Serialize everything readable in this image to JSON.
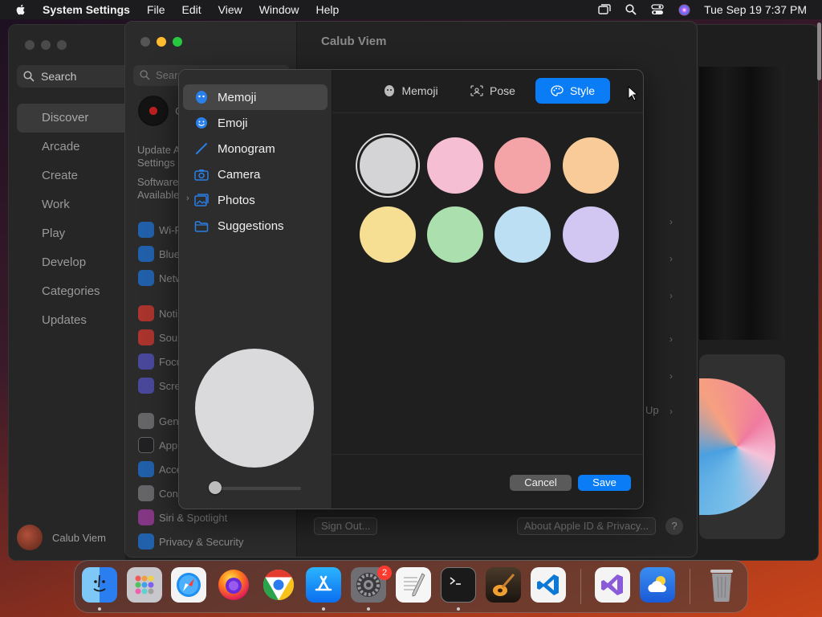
{
  "menubar": {
    "app_name": "System Settings",
    "menus": [
      "File",
      "Edit",
      "View",
      "Window",
      "Help"
    ],
    "clock": "Tue Sep 19  7:37 PM"
  },
  "appstore": {
    "search_label": "Search",
    "nav": [
      "Discover",
      "Arcade",
      "Create",
      "Work",
      "Play",
      "Develop",
      "Categories",
      "Updates"
    ],
    "active_nav": "Discover",
    "user_name": "Calub Viem"
  },
  "settings": {
    "window_title": "Calub Viem",
    "search_placeholder": "Search",
    "account_initial": "C",
    "update_line1": "Update A",
    "update_line2": "Settings",
    "software_line1": "Software",
    "software_line2": "Available",
    "sidebar_items": [
      {
        "label": "Wi-Fi",
        "color": "#1a84ff"
      },
      {
        "label": "Blue",
        "color": "#1a84ff"
      },
      {
        "label": "Netw",
        "color": "#1a84ff"
      },
      {
        "label": "Noti",
        "color": "#ff3b30"
      },
      {
        "label": "Sou",
        "color": "#ff3b30"
      },
      {
        "label": "Focu",
        "color": "#5e5ce6"
      },
      {
        "label": "Scre",
        "color": "#5e5ce6"
      },
      {
        "label": "Gen",
        "color": "#8e8e93"
      },
      {
        "label": "App",
        "color": "#1c1c1e"
      },
      {
        "label": "Acce",
        "color": "#1a84ff"
      },
      {
        "label": "Con",
        "color": "#8e8e93"
      },
      {
        "label": "Siri & Spotlight",
        "color": "#c040c0"
      },
      {
        "label": "Privacy & Security",
        "color": "#1a84ff"
      }
    ],
    "sign_out": "Sign Out...",
    "about": "About Apple ID & Privacy...",
    "help": "?",
    "up_fragment": "Up"
  },
  "dialog": {
    "sidebar": [
      {
        "label": "Memoji",
        "icon": "memoji-icon"
      },
      {
        "label": "Emoji",
        "icon": "emoji-icon"
      },
      {
        "label": "Monogram",
        "icon": "monogram-icon"
      },
      {
        "label": "Camera",
        "icon": "camera-icon"
      },
      {
        "label": "Photos",
        "icon": "photos-icon"
      },
      {
        "label": "Suggestions",
        "icon": "folder-icon"
      }
    ],
    "active_item": "Memoji",
    "tabs": [
      {
        "label": "Memoji",
        "icon": "memoji-face-icon"
      },
      {
        "label": "Pose",
        "icon": "pose-icon"
      },
      {
        "label": "Style",
        "icon": "palette-icon"
      }
    ],
    "active_tab": "Style",
    "colors": [
      "#d4d4d6",
      "#f6bed2",
      "#f4a3a6",
      "#f8cb98",
      "#f6df92",
      "#abe0ae",
      "#bddff3",
      "#d2c6f3"
    ],
    "selected_color": 0,
    "preview_color": "#dadadc",
    "slider_value": 0,
    "cancel_label": "Cancel",
    "save_label": "Save"
  },
  "dock": {
    "apps": [
      "Finder",
      "Launchpad",
      "Safari",
      "Firefox",
      "Chrome",
      "App Store",
      "System Settings",
      "TextEdit",
      "Terminal",
      "GarageBand",
      "Visual Studio Code",
      "Visual Studio",
      "Weather",
      "Trash"
    ],
    "settings_badge": "2"
  }
}
